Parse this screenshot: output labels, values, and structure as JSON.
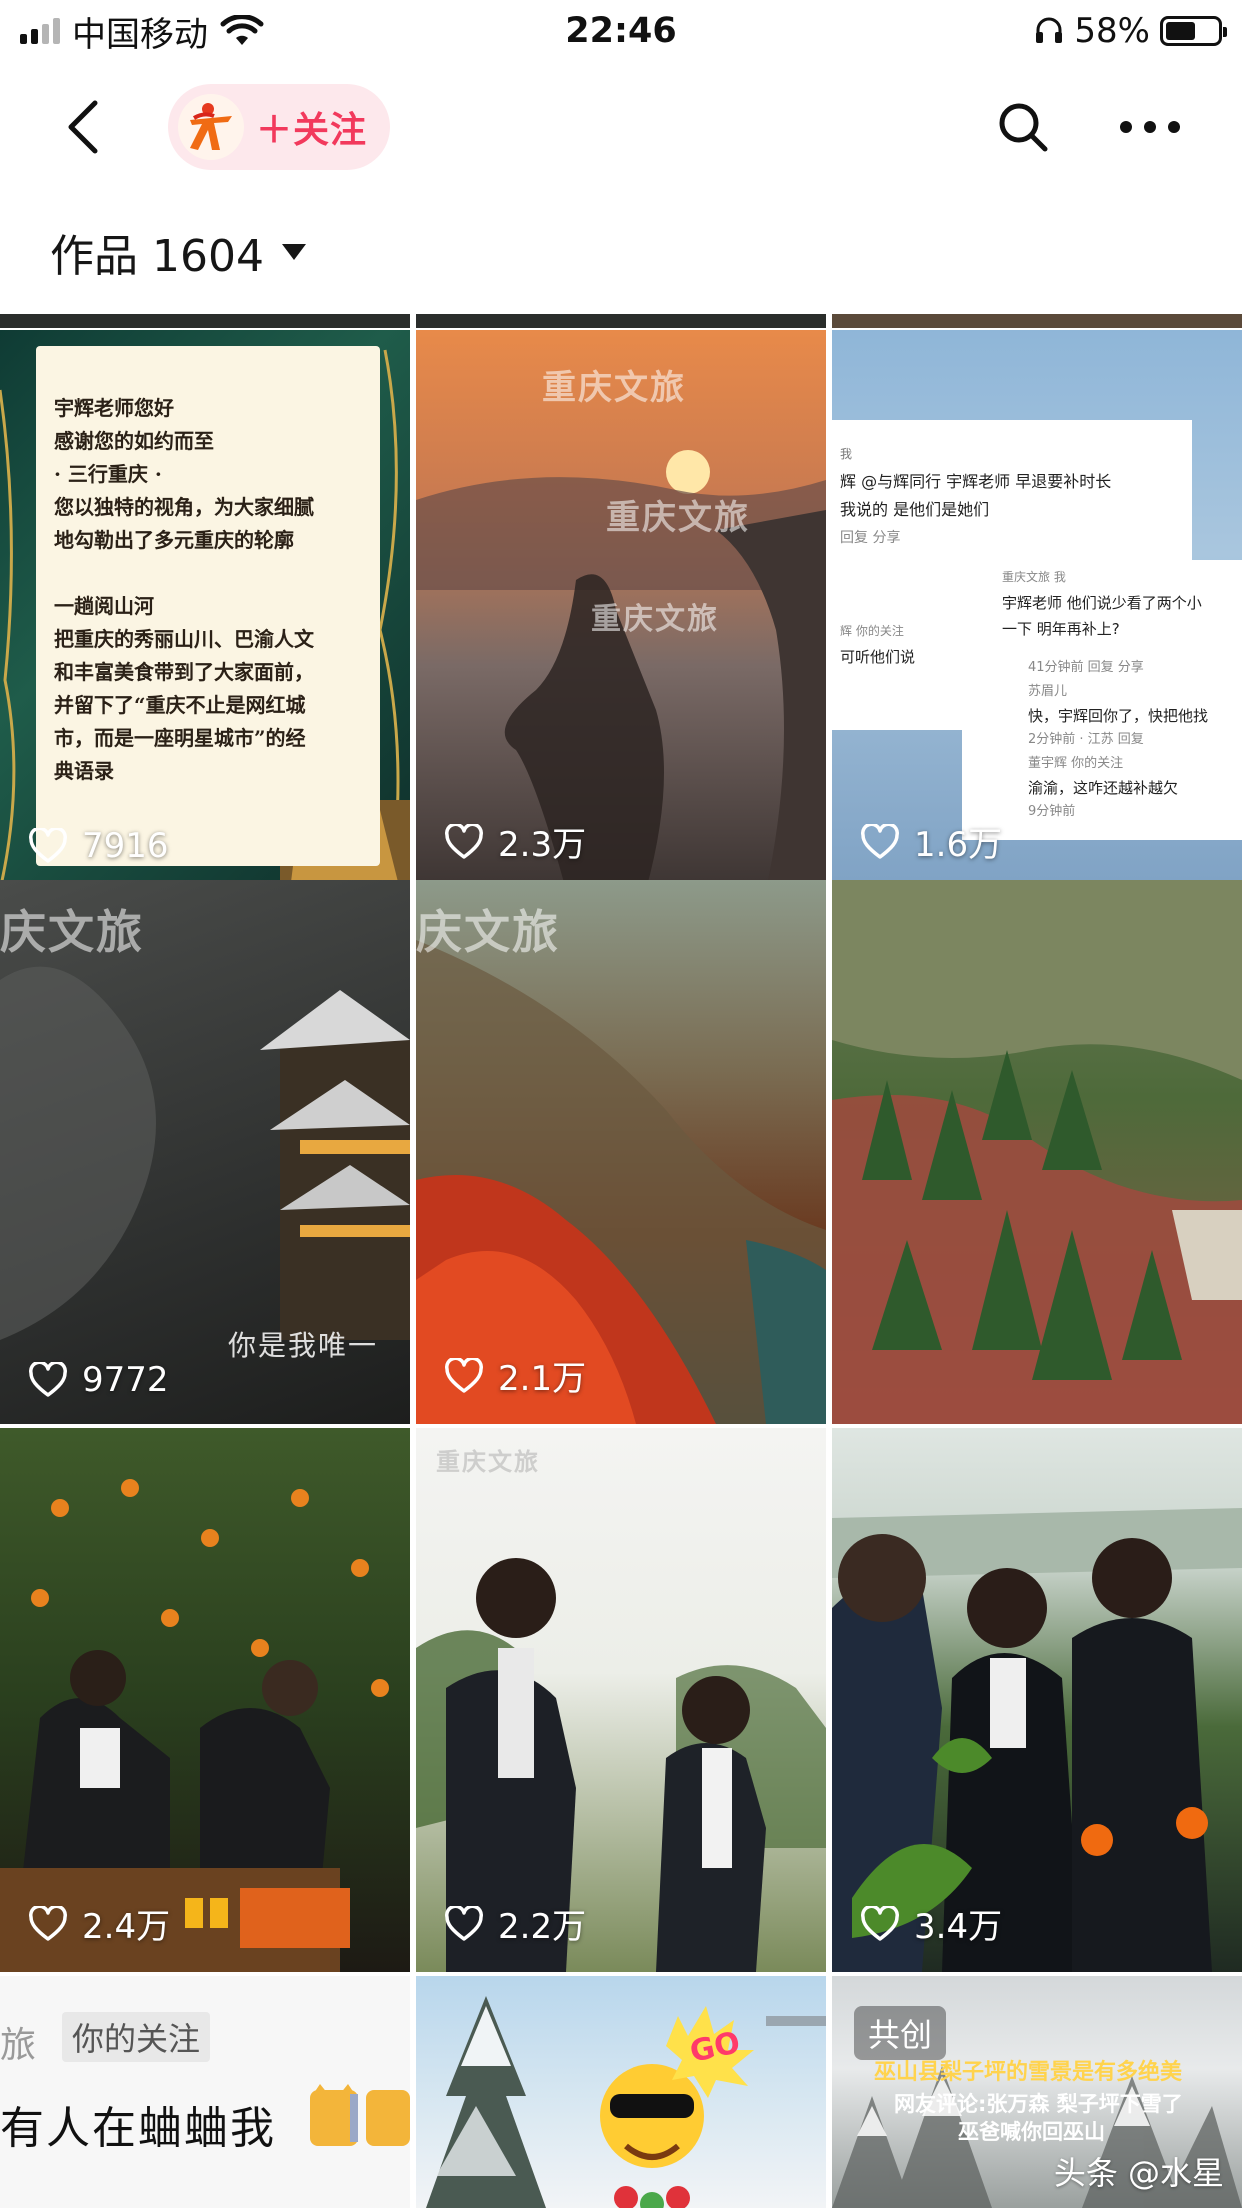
{
  "status_bar": {
    "carrier": "中国移动",
    "time": "22:46",
    "battery": "58%",
    "battery_level": 0.58
  },
  "nav": {
    "follow_label": "＋关注"
  },
  "works": {
    "label": "作品 1604"
  },
  "tiles": [
    {
      "likes": "7916",
      "text_lines": [
        "宇辉老师您好",
        "感谢您的如约而至",
        "· 三行重庆 ·",
        "您以独特的视角，为大家细腻",
        "地勾勒出了多元重庆的轮廓",
        "",
        "一趟阅山河",
        "把重庆的秀丽山川、巴渝人文",
        "和丰富美食带到了大家面前，",
        "并留下了“重庆不止是网红城",
        "市，而是一座明星城市”的经",
        "典语录"
      ]
    },
    {
      "likes": "2.3万",
      "watermark": "重庆文旅"
    },
    {
      "likes": "1.6万",
      "comments": [
        "我",
        "辉 @与辉同行 宇辉老师 早退要补时长",
        "我说的 是他们是她们",
        "回复  分享",
        "重庆文旅 我",
        "宇辉老师 他们说少看了两个小",
        "一下 明年再补上?",
        "辉 你的关注",
        "可听他们说",
        "41分钟前  回复  分享",
        "苏眉儿",
        "快，宇辉回你了，快把他找",
        "2分钟前 · 江苏  回复",
        "董宇辉 你的关注",
        "渝渝，这咋还越补越欠",
        "9分钟前"
      ]
    },
    {
      "likes": "9772",
      "watermark": "庆文旅",
      "subtitle": "你是我唯一"
    },
    {
      "likes": "2.1万",
      "watermark": "庆文旅"
    },
    {
      "likes": ""
    },
    {
      "likes": "2.4万"
    },
    {
      "likes": "2.2万",
      "watermark": "重庆文旅"
    },
    {
      "likes": "3.4万"
    },
    {
      "tag": "你的关注",
      "prefix": "旅",
      "caption": "有人在蛐蛐我"
    },
    {
      "badge": "GO"
    },
    {
      "badge": "共创",
      "caption_line1": "巫山县梨子坪的雪景是有多绝美",
      "caption_line2": "网友评论:张万森  梨子坪下雪了",
      "caption_line3": "巫爸喊你回巫山",
      "footer": "头条 @水星"
    }
  ]
}
